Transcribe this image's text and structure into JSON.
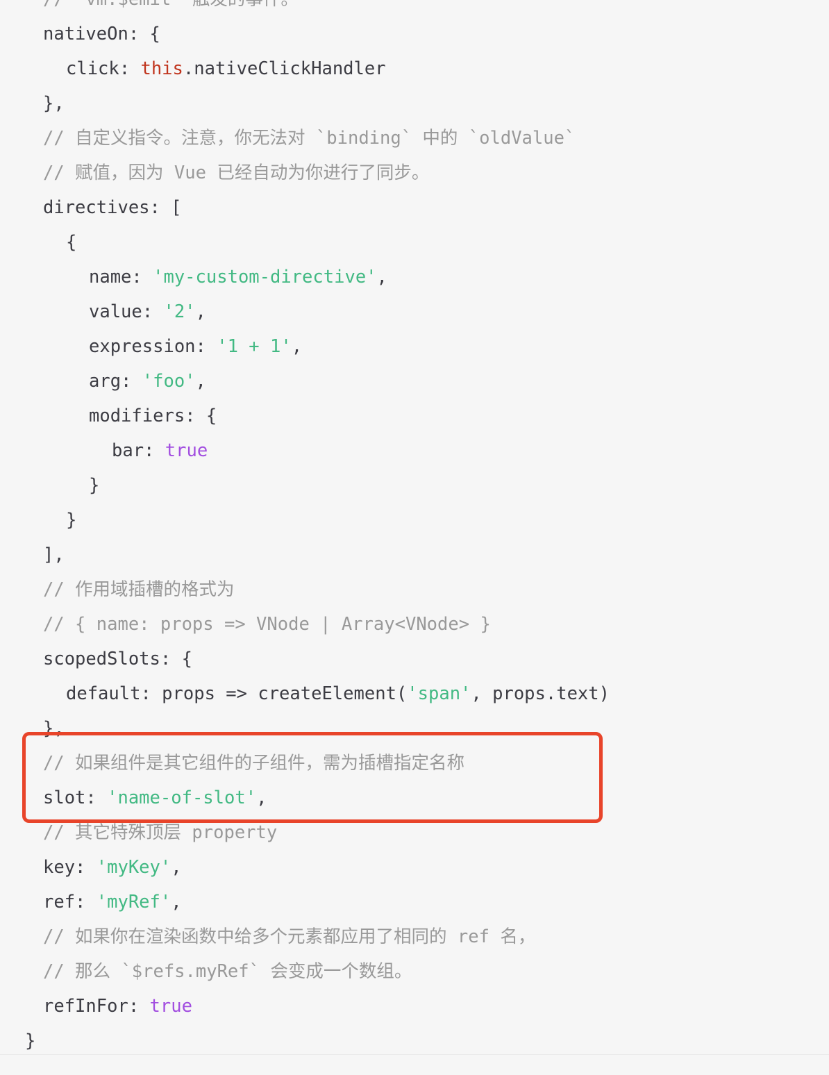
{
  "page": {
    "kind": "code-block",
    "language": "js",
    "background_color": "#f6f6f6",
    "text_color": "#3c3c43",
    "comment_color": "#999999",
    "string_color": "#42b983",
    "keyword_color": "#a24ee0",
    "this_color": "#c0341d"
  },
  "annotation": {
    "shape": "rectangle",
    "color": "#e8442a",
    "target_lines": [
      "// 如果组件是其它组件的子组件，需为插槽指定名称",
      "slot: 'name-of-slot',"
    ]
  },
  "code": {
    "lines": [
      {
        "indent": 0,
        "clipped": true,
        "parts": [
          {
            "t": "// `vm.$emit` 触发的事件。",
            "c": "cmt"
          }
        ]
      },
      {
        "indent": 0,
        "parts": [
          {
            "t": "nativeOn: {",
            "c": "plain"
          }
        ]
      },
      {
        "indent": 1,
        "parts": [
          {
            "t": "click: ",
            "c": "plain"
          },
          {
            "t": "this",
            "c": "tok-this"
          },
          {
            "t": ".nativeClickHandler",
            "c": "plain"
          }
        ]
      },
      {
        "indent": 0,
        "parts": [
          {
            "t": "},",
            "c": "plain"
          }
        ]
      },
      {
        "indent": 0,
        "parts": [
          {
            "t": "// 自定义指令。注意，你无法对 `binding` 中的 `oldValue`",
            "c": "cmt"
          }
        ]
      },
      {
        "indent": 0,
        "parts": [
          {
            "t": "// 赋值，因为 Vue 已经自动为你进行了同步。",
            "c": "cmt"
          }
        ]
      },
      {
        "indent": 0,
        "parts": [
          {
            "t": "directives: [",
            "c": "plain"
          }
        ]
      },
      {
        "indent": 1,
        "parts": [
          {
            "t": "{",
            "c": "plain"
          }
        ]
      },
      {
        "indent": 2,
        "parts": [
          {
            "t": "name: ",
            "c": "plain"
          },
          {
            "t": "'my-custom-directive'",
            "c": "str"
          },
          {
            "t": ",",
            "c": "plain"
          }
        ]
      },
      {
        "indent": 2,
        "parts": [
          {
            "t": "value: ",
            "c": "plain"
          },
          {
            "t": "'2'",
            "c": "str"
          },
          {
            "t": ",",
            "c": "plain"
          }
        ]
      },
      {
        "indent": 2,
        "parts": [
          {
            "t": "expression: ",
            "c": "plain"
          },
          {
            "t": "'1 + 1'",
            "c": "str"
          },
          {
            "t": ",",
            "c": "plain"
          }
        ]
      },
      {
        "indent": 2,
        "parts": [
          {
            "t": "arg: ",
            "c": "plain"
          },
          {
            "t": "'foo'",
            "c": "str"
          },
          {
            "t": ",",
            "c": "plain"
          }
        ]
      },
      {
        "indent": 2,
        "parts": [
          {
            "t": "modifiers: {",
            "c": "plain"
          }
        ]
      },
      {
        "indent": 3,
        "parts": [
          {
            "t": "bar: ",
            "c": "plain"
          },
          {
            "t": "true",
            "c": "kw"
          }
        ]
      },
      {
        "indent": 2,
        "parts": [
          {
            "t": "}",
            "c": "plain"
          }
        ]
      },
      {
        "indent": 1,
        "parts": [
          {
            "t": "}",
            "c": "plain"
          }
        ]
      },
      {
        "indent": 0,
        "parts": [
          {
            "t": "],",
            "c": "plain"
          }
        ]
      },
      {
        "indent": 0,
        "parts": [
          {
            "t": "// 作用域插槽的格式为",
            "c": "cmt"
          }
        ]
      },
      {
        "indent": 0,
        "parts": [
          {
            "t": "// { name: props => VNode | Array<VNode> }",
            "c": "cmt"
          }
        ]
      },
      {
        "indent": 0,
        "parts": [
          {
            "t": "scopedSlots: {",
            "c": "plain"
          }
        ]
      },
      {
        "indent": 1,
        "parts": [
          {
            "t": "default: props => createElement(",
            "c": "plain"
          },
          {
            "t": "'span'",
            "c": "str"
          },
          {
            "t": ", props.text)",
            "c": "plain"
          }
        ]
      },
      {
        "indent": 0,
        "parts": [
          {
            "t": "},",
            "c": "plain"
          }
        ]
      },
      {
        "indent": 0,
        "parts": [
          {
            "t": "// 如果组件是其它组件的子组件，需为插槽指定名称",
            "c": "cmt"
          }
        ]
      },
      {
        "indent": 0,
        "parts": [
          {
            "t": "slot: ",
            "c": "plain"
          },
          {
            "t": "'name-of-slot'",
            "c": "str"
          },
          {
            "t": ",",
            "c": "plain"
          }
        ]
      },
      {
        "indent": 0,
        "parts": [
          {
            "t": "// 其它特殊顶层 property",
            "c": "cmt"
          }
        ]
      },
      {
        "indent": 0,
        "parts": [
          {
            "t": "key: ",
            "c": "plain"
          },
          {
            "t": "'myKey'",
            "c": "str"
          },
          {
            "t": ",",
            "c": "plain"
          }
        ]
      },
      {
        "indent": 0,
        "parts": [
          {
            "t": "ref: ",
            "c": "plain"
          },
          {
            "t": "'myRef'",
            "c": "str"
          },
          {
            "t": ",",
            "c": "plain"
          }
        ]
      },
      {
        "indent": 0,
        "parts": [
          {
            "t": "// 如果你在渲染函数中给多个元素都应用了相同的 ref 名，",
            "c": "cmt"
          }
        ]
      },
      {
        "indent": 0,
        "parts": [
          {
            "t": "// 那么 `$refs.myRef` 会变成一个数组。",
            "c": "cmt"
          }
        ]
      },
      {
        "indent": 0,
        "parts": [
          {
            "t": "refInFor: ",
            "c": "plain"
          },
          {
            "t": "true",
            "c": "kw"
          }
        ]
      },
      {
        "indent": -1,
        "parts": [
          {
            "t": "}",
            "c": "plain"
          }
        ]
      }
    ]
  }
}
